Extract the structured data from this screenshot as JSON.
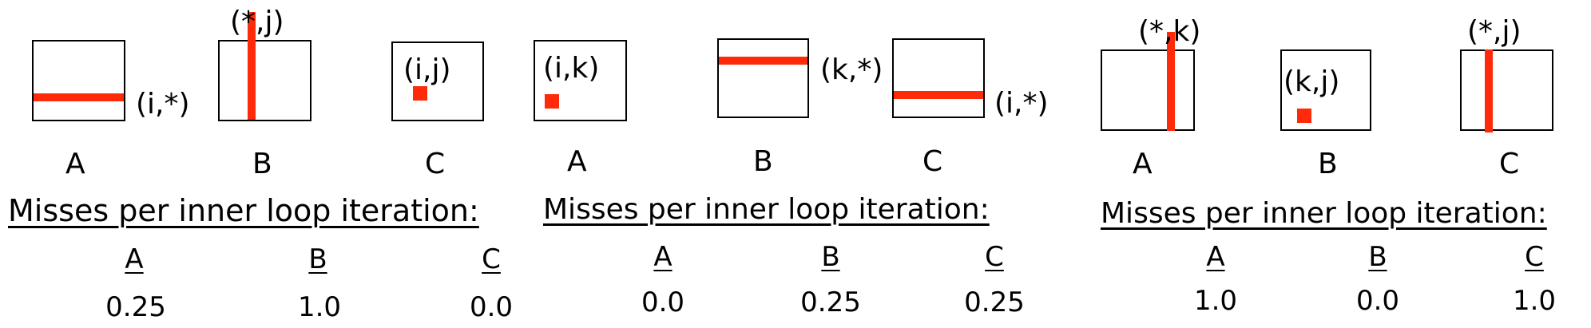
{
  "colors": {
    "access_pattern": "#ff2a0a",
    "outline": "#000000"
  },
  "panels": [
    {
      "matrices": [
        {
          "name": "A",
          "access_label": "(i,*)",
          "pattern": "row"
        },
        {
          "name": "B",
          "access_label": "(*,j)",
          "pattern": "column"
        },
        {
          "name": "C",
          "access_label": "(i,j)",
          "pattern": "element"
        }
      ],
      "heading": "Misses per inner loop iteration:",
      "misses": [
        {
          "matrix": "A",
          "value": "0.25"
        },
        {
          "matrix": "B",
          "value": "1.0"
        },
        {
          "matrix": "C",
          "value": "0.0"
        }
      ]
    },
    {
      "matrices": [
        {
          "name": "A",
          "access_label": "(i,k)",
          "pattern": "element"
        },
        {
          "name": "B",
          "access_label": "(k,*)",
          "pattern": "row"
        },
        {
          "name": "C",
          "access_label": "(i,*)",
          "pattern": "row"
        }
      ],
      "heading": "Misses per inner loop iteration:",
      "misses": [
        {
          "matrix": "A",
          "value": "0.0"
        },
        {
          "matrix": "B",
          "value": "0.25"
        },
        {
          "matrix": "C",
          "value": "0.25"
        }
      ]
    },
    {
      "matrices": [
        {
          "name": "A",
          "access_label": "(*,k)",
          "pattern": "column"
        },
        {
          "name": "B",
          "access_label": "(k,j)",
          "pattern": "element"
        },
        {
          "name": "C",
          "access_label": "(*,j)",
          "pattern": "column"
        }
      ],
      "heading": "Misses per inner loop iteration:",
      "misses": [
        {
          "matrix": "A",
          "value": "1.0"
        },
        {
          "matrix": "B",
          "value": "0.0"
        },
        {
          "matrix": "C",
          "value": "1.0"
        }
      ]
    }
  ]
}
